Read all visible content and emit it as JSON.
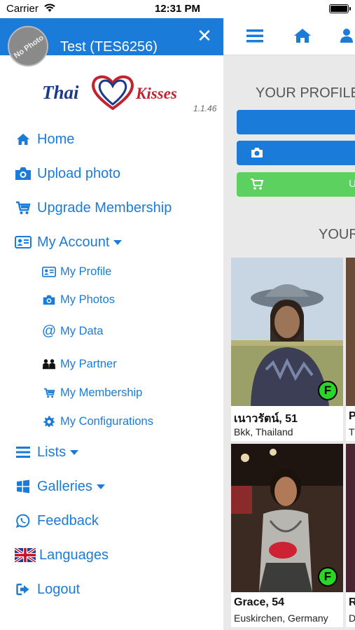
{
  "status_bar": {
    "carrier": "Carrier",
    "time": "12:31 PM"
  },
  "drawer": {
    "user_name": "Test (TES6256)",
    "avatar_text": "No Photo",
    "logo": {
      "left": "Thai",
      "right": "Kisses"
    },
    "version": "1.1.46",
    "menu": {
      "home": "Home",
      "upload_photo": "Upload photo",
      "upgrade": "Upgrade Membership",
      "my_account": "My Account",
      "my_profile": "My Profile",
      "my_photos": "My Photos",
      "my_data": "My Data",
      "my_partner": "My Partner",
      "my_membership": "My Membership",
      "my_configurations": "My Configurations",
      "lists": "Lists",
      "galleries": "Galleries",
      "feedback": "Feedback",
      "languages": "Languages",
      "logout": "Logout"
    }
  },
  "main": {
    "profile_title": "YOUR PROFILE",
    "green_button_text": "U",
    "section_title": "YOUR",
    "cards": [
      {
        "name": "เนาวรัตน์, 51",
        "location": "Bkk, Thailand",
        "badge": "F"
      },
      {
        "name": "Grace, 54",
        "location": "Euskirchen, Germany",
        "badge": "F"
      }
    ],
    "cut_cards": [
      {
        "name": "P",
        "location": "T"
      },
      {
        "name": "R",
        "location": "D"
      }
    ]
  },
  "colors": {
    "accent": "#1b7bd8",
    "green": "#5cd160",
    "badge": "#28d628"
  }
}
